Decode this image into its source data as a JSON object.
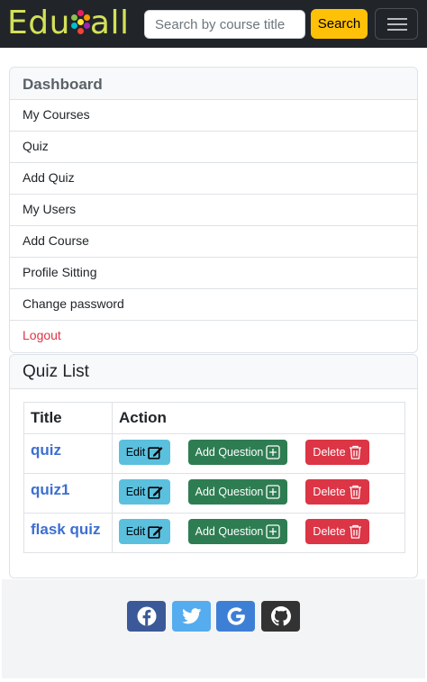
{
  "navbar": {
    "logo_prefix": "Edu",
    "logo_suffix": "all",
    "search_placeholder": "Search by course title",
    "search_button": "Search",
    "menu_icon": "hamburger-icon"
  },
  "sidebar": {
    "header": "Dashboard",
    "items": [
      {
        "label": "My Courses"
      },
      {
        "label": "Quiz"
      },
      {
        "label": "Add Quiz"
      },
      {
        "label": "My Users"
      },
      {
        "label": "Add Course"
      },
      {
        "label": "Profile Sitting"
      },
      {
        "label": "Change password"
      },
      {
        "label": "Logout"
      }
    ]
  },
  "quiz_list": {
    "title": "Quiz List",
    "columns": [
      "Title",
      "Action"
    ],
    "rows": [
      {
        "title": "quiz"
      },
      {
        "title": "quiz1"
      },
      {
        "title": "flask quiz"
      }
    ],
    "edit_label": "Edit",
    "add_question_label": "Add Question",
    "delete_label": "Delete"
  },
  "footer": {
    "social": [
      "facebook-icon",
      "twitter-icon",
      "google-icon",
      "github-icon"
    ]
  },
  "colors": {
    "navbar_bg": "#212529",
    "logo": "#d4e157",
    "search_button": "#ffc107",
    "logout_text": "#dc3545",
    "quiz_link": "#3d6fd0",
    "edit_button": "#5bc0de",
    "add_question_button": "#2e7d52",
    "delete_button": "#dc3545",
    "facebook": "#3b5998",
    "twitter": "#55acee",
    "google": "#3e7fd6",
    "github": "#333333"
  }
}
